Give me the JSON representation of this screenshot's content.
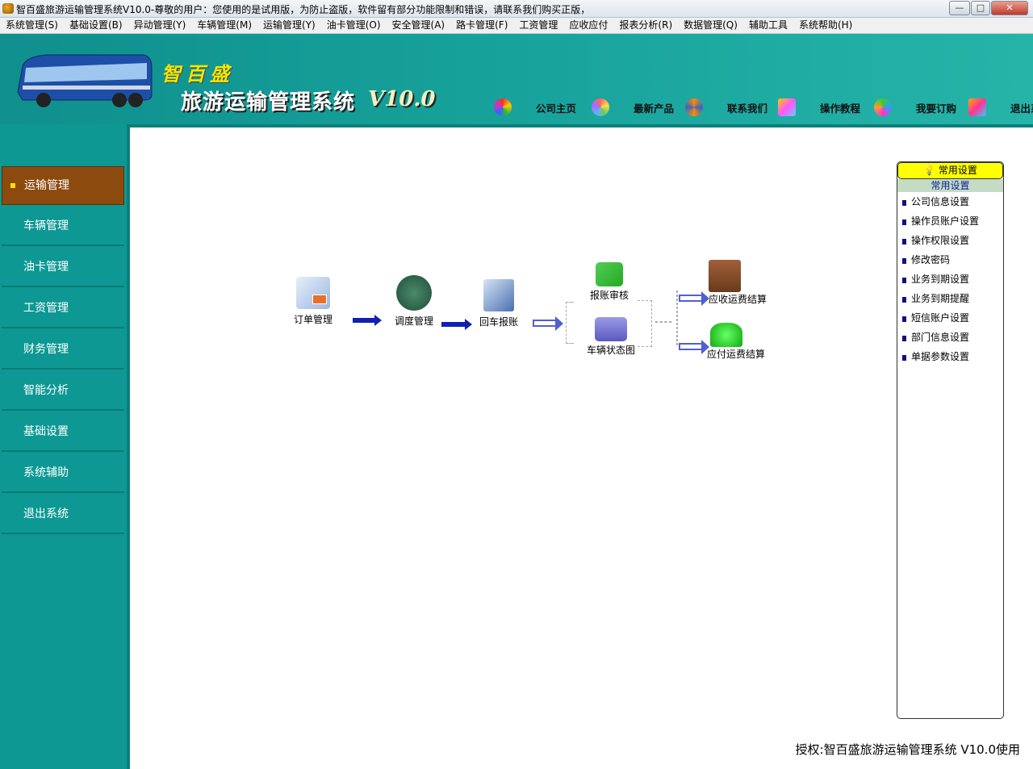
{
  "window": {
    "title": "智百盛旅游运输管理系统V10.0-尊敬的用户：您使用的是试用版，为防止盗版，软件留有部分功能限制和错误，请联系我们购买正版，",
    "min": "—",
    "max": "□",
    "close": "✕"
  },
  "menu": [
    "系统管理(S)",
    "基础设置(B)",
    "异动管理(Y)",
    "车辆管理(M)",
    "运输管理(Y)",
    "油卡管理(O)",
    "安全管理(A)",
    "路卡管理(F)",
    "工资管理",
    "应收应付",
    "报表分析(R)",
    "数据管理(Q)",
    "辅助工具",
    "系统帮助(H)"
  ],
  "header": {
    "brand_top": "智百盛",
    "brand_main": "旅游运输管理系统",
    "version": "V10.0",
    "links": [
      "公司主页",
      "最新产品",
      "联系我们",
      "操作教程",
      "我要订购",
      "退出系统"
    ]
  },
  "sidebar": [
    "运输管理",
    "车辆管理",
    "油卡管理",
    "工资管理",
    "财务管理",
    "智能分析",
    "基础设置",
    "系统辅助",
    "退出系统"
  ],
  "flow": {
    "order": "订单管理",
    "dispatch": "调度管理",
    "return": "回车报账",
    "audit": "报账审核",
    "vehicle_status": "车辆状态图",
    "receivable": "应收运费结算",
    "payable": "应付运费结算"
  },
  "panel": {
    "title": "常用设置",
    "subtitle": "常用设置",
    "items": [
      "公司信息设置",
      "操作员账户设置",
      "操作权限设置",
      "修改密码",
      "业务到期设置",
      "业务到期提醒",
      "短信账户设置",
      "部门信息设置",
      "单据参数设置"
    ]
  },
  "footer": "授权:智百盛旅游运输管理系统 V10.0使用"
}
